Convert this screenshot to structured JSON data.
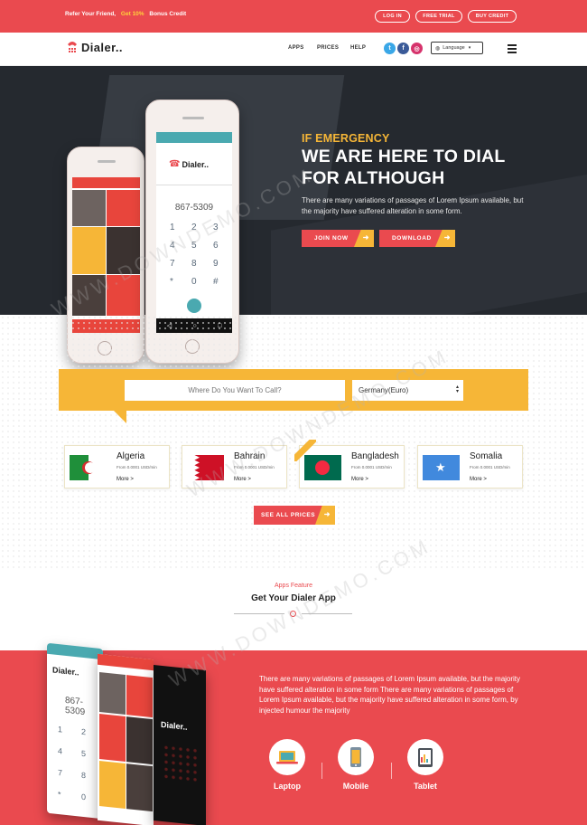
{
  "topbar": {
    "promo_left": "Refer Your Friend,",
    "promo_highlight": "Get 10%",
    "promo_right": "Bonus Credit",
    "buttons": [
      "LOG IN",
      "FREE TRIAL",
      "BUY CREDIT"
    ]
  },
  "nav": {
    "logo": "Dialer..",
    "links": [
      "APPS",
      "PRICES",
      "HELP"
    ],
    "social": [
      {
        "icon": "twitter-icon",
        "glyph": "t",
        "color": "#3aa7e7"
      },
      {
        "icon": "facebook-icon",
        "glyph": "f",
        "color": "#3a5a98"
      },
      {
        "icon": "instagram-icon",
        "glyph": "◎",
        "color": "#d6336c"
      }
    ],
    "language": "Language"
  },
  "hero": {
    "eyebrow": "IF EMERGENCY",
    "title": "WE ARE HERE TO DIAL FOR ALTHOUGH",
    "text": "There are many variations of passages of Lorem Ipsum available, but the majority have suffered alteration in some form.",
    "join_label": "JOIN NOW",
    "download_label": "DOWNLOAD"
  },
  "phone": {
    "app_name": "Dialer..",
    "number": "867-5309",
    "keys": [
      "1",
      "2",
      "3",
      "4",
      "5",
      "6",
      "7",
      "8",
      "9",
      "*",
      "0",
      "#"
    ]
  },
  "search": {
    "placeholder": "Where Do You Want To Call?",
    "currency": "Germany(Euro)"
  },
  "countries": [
    {
      "name": "Algeria",
      "rate": "From 0.0001 USD/min",
      "more": "More >"
    },
    {
      "name": "Bahrain",
      "rate": "From 0.0001 USD/min",
      "more": "More >"
    },
    {
      "name": "Bangladesh",
      "rate": "From 0.0001 USD/min",
      "more": "More >"
    },
    {
      "name": "Somalia",
      "rate": "From 0.0001 USD/min",
      "more": "More >"
    }
  ],
  "see_all": "SEE ALL PRICES",
  "apps": {
    "subtitle": "Apps Feature",
    "title": "Get Your Dialer App",
    "text": "There are many variations of passages of Lorem Ipsum available, but the majority have suffered alteration in some form There are many variations of passages of Lorem Ipsum available, but the majority have suffered alteration in some form, by injected humour the majority",
    "devices": [
      "Laptop",
      "Mobile",
      "Tablet"
    ]
  },
  "watermark": "WWW.DOWNDEMO.COM",
  "colors": {
    "primary": "#ea4a4f",
    "accent": "#f6b637",
    "dark": "#2f343a"
  }
}
